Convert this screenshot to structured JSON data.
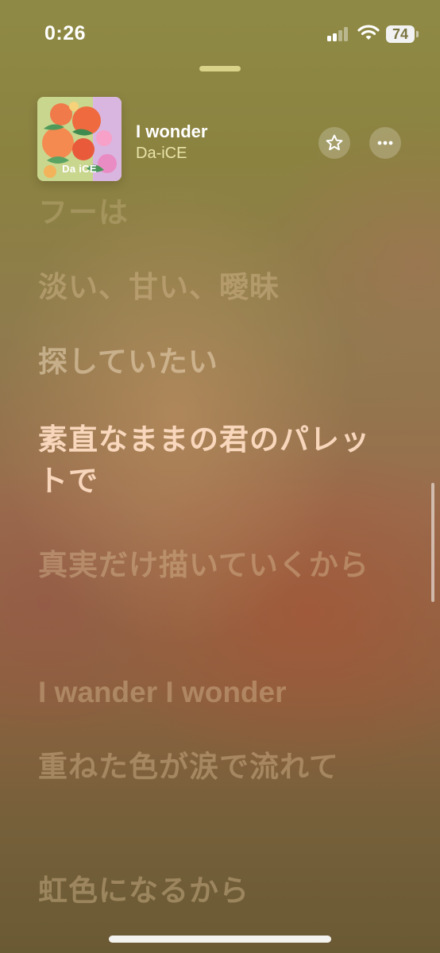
{
  "status_bar": {
    "time": "0:26",
    "battery_level": "74",
    "signal_bars_active": 2,
    "signal_bars_total": 4,
    "icons": [
      "cellular-signal-icon",
      "wifi-icon",
      "battery-icon"
    ]
  },
  "now_playing": {
    "title": "I wonder",
    "artist": "Da-iCE",
    "artwork_text": "Da iCE",
    "favorite_icon": "star-icon",
    "more_icon": "ellipsis-icon"
  },
  "lyrics": [
    {
      "text": "フーは",
      "state": "cut"
    },
    {
      "text": "淡い、甘い、曖昧",
      "state": "faded"
    },
    {
      "text": "探していたい",
      "state": "prev"
    },
    {
      "text": "素直なままの君のパレットで",
      "state": "active"
    },
    {
      "text": "真実だけ描いていくから",
      "state": "faded"
    },
    {
      "text": "I wander I wonder",
      "state": "faded"
    },
    {
      "text": "重ねた色が涙で流れて",
      "state": "faded"
    },
    {
      "text": "虹色になるから",
      "state": "faded"
    }
  ],
  "colors": {
    "artist_text": "#e8e3a8",
    "grabber": "#d9d38a",
    "active_lyric": "#ffdec6"
  }
}
